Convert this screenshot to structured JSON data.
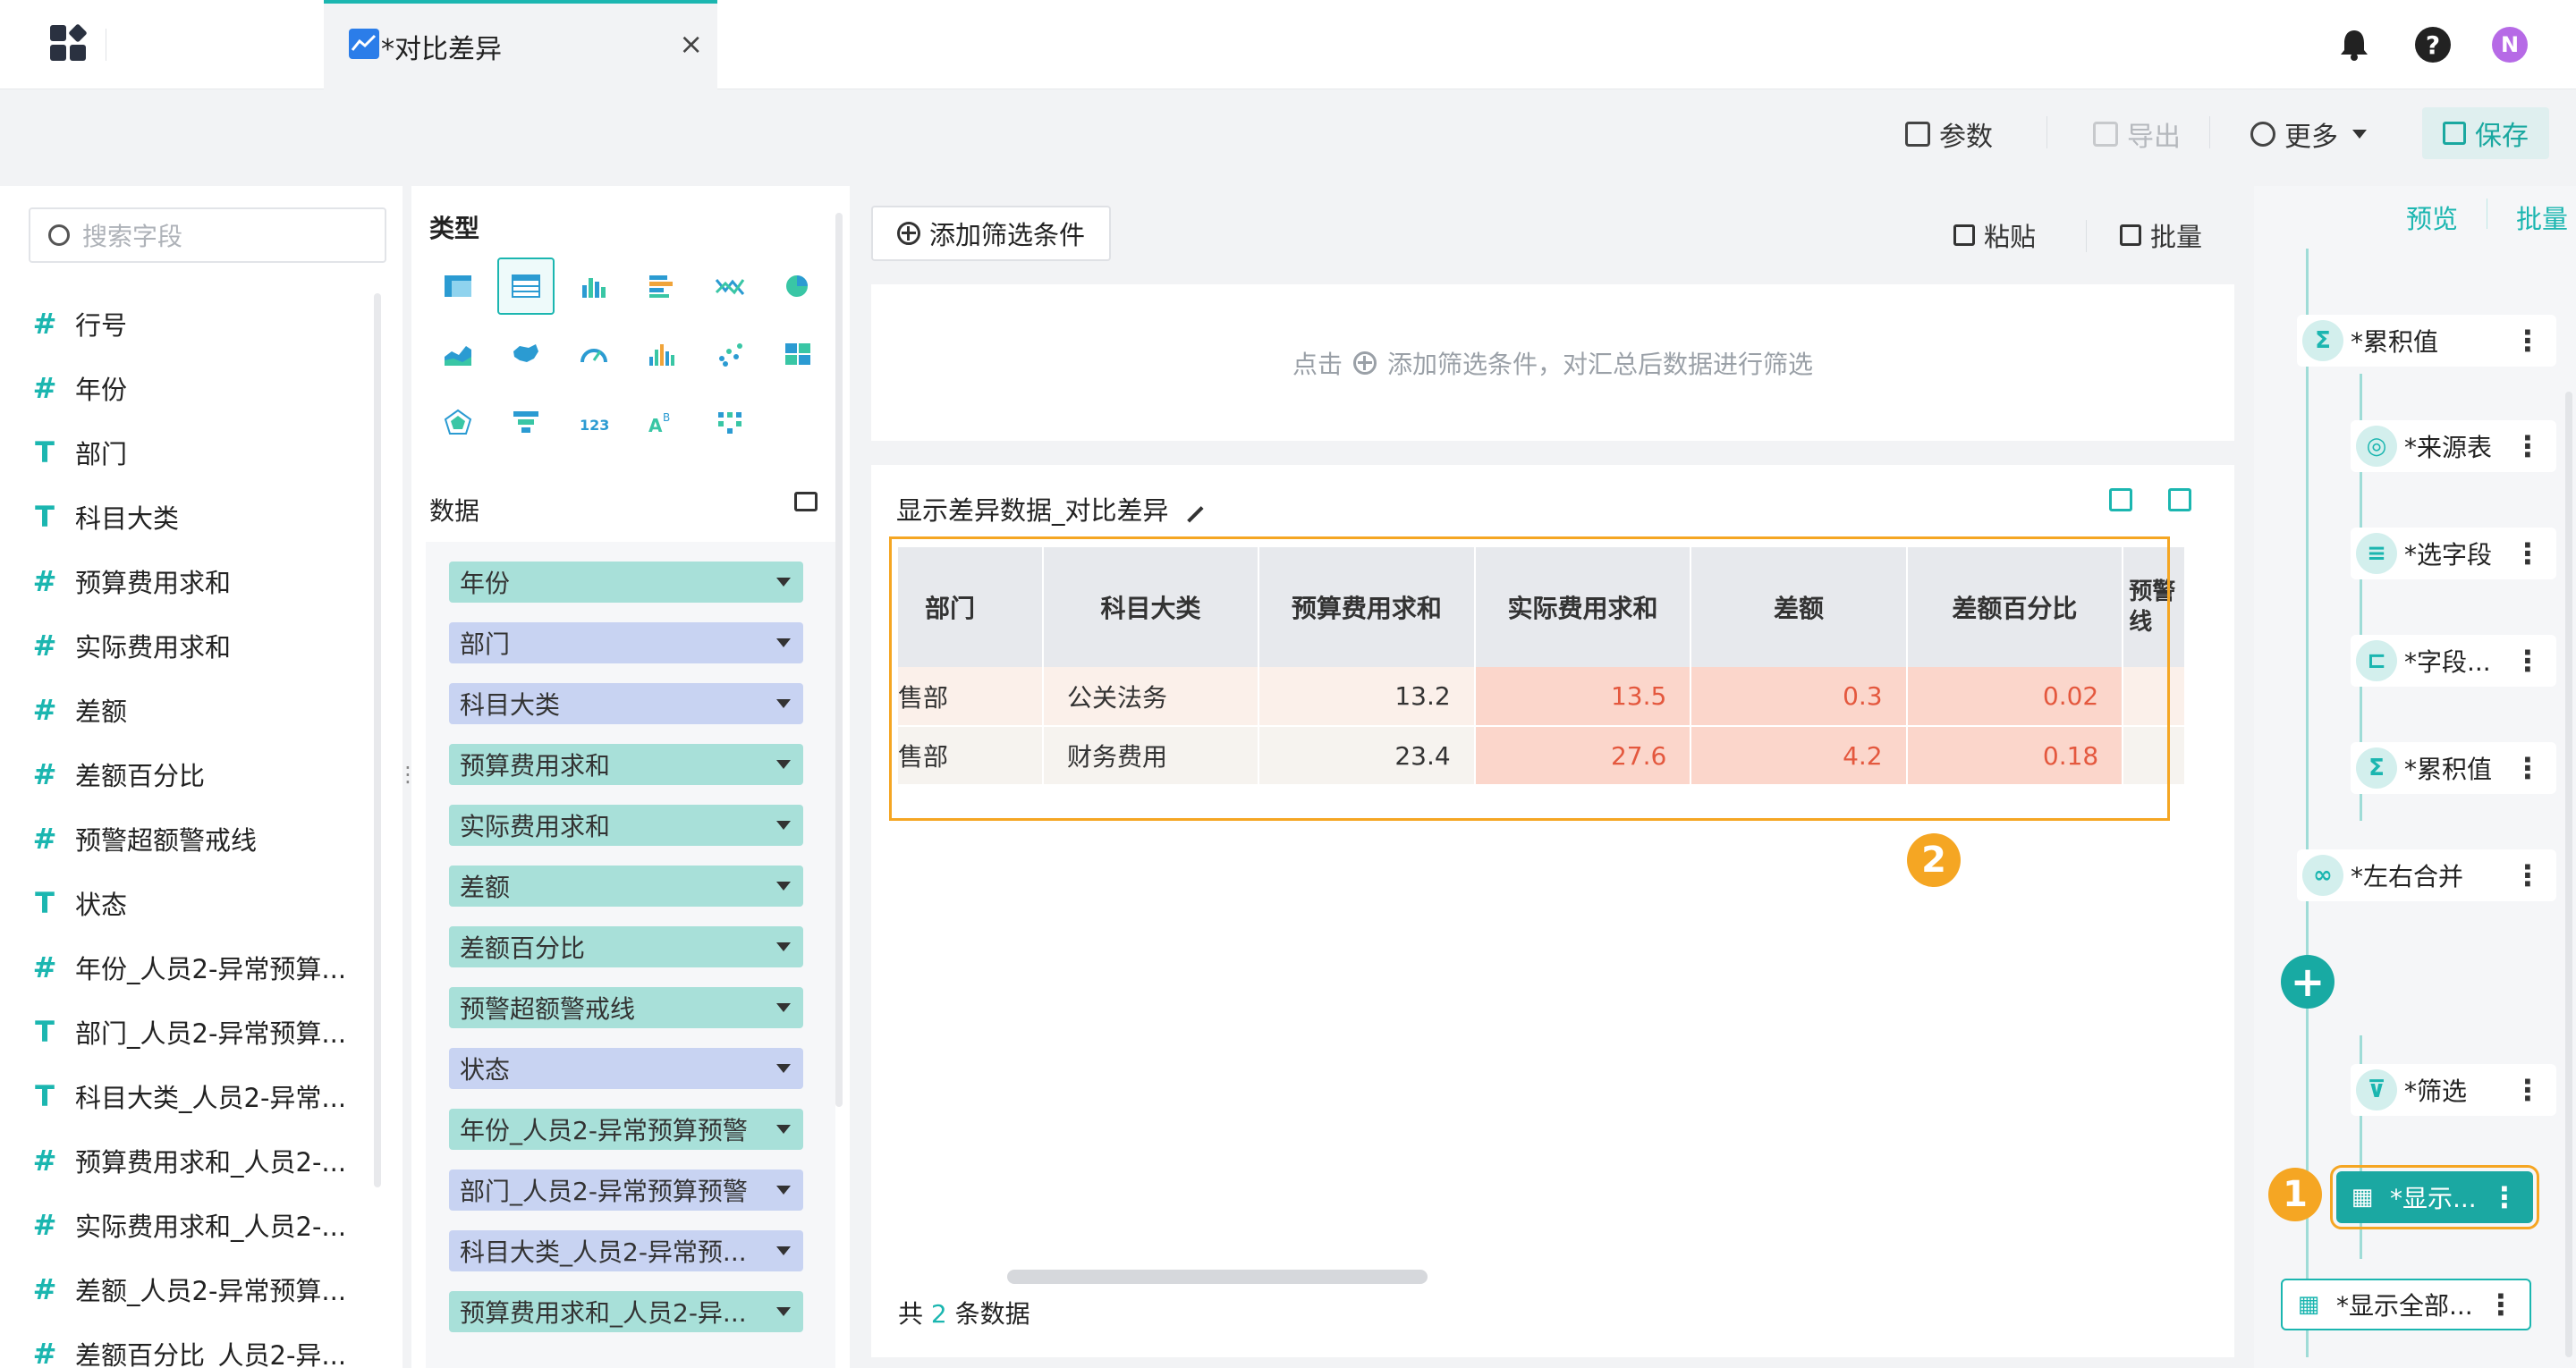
{
  "topbar": {
    "tab_title": "*对比差异",
    "close": "×",
    "help": "?",
    "avatar": "N"
  },
  "toolbar": {
    "params": "参数",
    "export": "导出",
    "more": "更多",
    "save": "保存"
  },
  "left": {
    "search_placeholder": "搜索字段",
    "fields": [
      {
        "type": "#",
        "name": "行号"
      },
      {
        "type": "#",
        "name": "年份"
      },
      {
        "type": "T",
        "name": "部门"
      },
      {
        "type": "T",
        "name": "科目大类"
      },
      {
        "type": "#",
        "name": "预算费用求和"
      },
      {
        "type": "#",
        "name": "实际费用求和"
      },
      {
        "type": "#",
        "name": "差额"
      },
      {
        "type": "#",
        "name": "差额百分比"
      },
      {
        "type": "#",
        "name": "预警超额警戒线"
      },
      {
        "type": "T",
        "name": "状态"
      },
      {
        "type": "#",
        "name": "年份_人员2-异常预算..."
      },
      {
        "type": "T",
        "name": "部门_人员2-异常预算..."
      },
      {
        "type": "T",
        "name": "科目大类_人员2-异常..."
      },
      {
        "type": "#",
        "name": "预算费用求和_人员2-..."
      },
      {
        "type": "#",
        "name": "实际费用求和_人员2-..."
      },
      {
        "type": "#",
        "name": "差额_人员2-异常预算..."
      },
      {
        "type": "#",
        "name": "差额百分比_人员2-异..."
      }
    ]
  },
  "mid": {
    "type_title": "类型",
    "data_title": "数据",
    "pills": [
      {
        "label": "年份",
        "kind": "dim"
      },
      {
        "label": "部门",
        "kind": "meas"
      },
      {
        "label": "科目大类",
        "kind": "meas"
      },
      {
        "label": "预算费用求和",
        "kind": "dim"
      },
      {
        "label": "实际费用求和",
        "kind": "dim"
      },
      {
        "label": "差额",
        "kind": "dim"
      },
      {
        "label": "差额百分比",
        "kind": "dim"
      },
      {
        "label": "预警超额警戒线",
        "kind": "dim"
      },
      {
        "label": "状态",
        "kind": "meas"
      },
      {
        "label": "年份_人员2-异常预算预警",
        "kind": "dim"
      },
      {
        "label": "部门_人员2-异常预算预警",
        "kind": "meas"
      },
      {
        "label": "科目大类_人员2-异常预...",
        "kind": "meas"
      },
      {
        "label": "预算费用求和_人员2-异...",
        "kind": "dim"
      }
    ]
  },
  "center": {
    "add_filter": "添加筛选条件",
    "paste": "粘贴",
    "batch": "批量",
    "filter_hint_pre": "点击",
    "filter_hint_post": "添加筛选条件，对汇总后数据进行筛选",
    "result_title": "显示差异数据_对比差异",
    "table": {
      "headers": [
        "部门",
        "科目大类",
        "预算费用求和",
        "实际费用求和",
        "差额",
        "差额百分比",
        "预警线"
      ],
      "rows": [
        [
          "售部",
          "公关法务",
          "13.2",
          "13.5",
          "0.3",
          "0.02"
        ],
        [
          "售部",
          "财务费用",
          "23.4",
          "27.6",
          "4.2",
          "0.18"
        ]
      ]
    },
    "footer_pre": "共",
    "footer_count": "2",
    "footer_post": "条数据",
    "badge2": "2"
  },
  "flow": {
    "preview": "预览",
    "batch": "批量",
    "nodes": [
      {
        "label": "*累积值",
        "icon": "Σ"
      },
      {
        "label": "*来源表",
        "icon": "◎"
      },
      {
        "label": "*选字段",
        "icon": "≡"
      },
      {
        "label": "*字段...",
        "icon": "⊏"
      },
      {
        "label": "*累积值",
        "icon": "Σ"
      },
      {
        "label": "*左右合并",
        "icon": "∞"
      },
      {
        "label": "*筛选",
        "icon": "⊽"
      },
      {
        "label": "*显示...",
        "icon": "▦"
      },
      {
        "label": "*显示全部...",
        "icon": "▦"
      }
    ],
    "add": "+",
    "badge1": "1",
    "more": "⋮"
  },
  "colors": {
    "accent": "#1bb6b0",
    "highlight_box": "#f5a623",
    "diff_cell_bg": "#fbd6cb",
    "diff_cell_text": "#e4583e"
  }
}
